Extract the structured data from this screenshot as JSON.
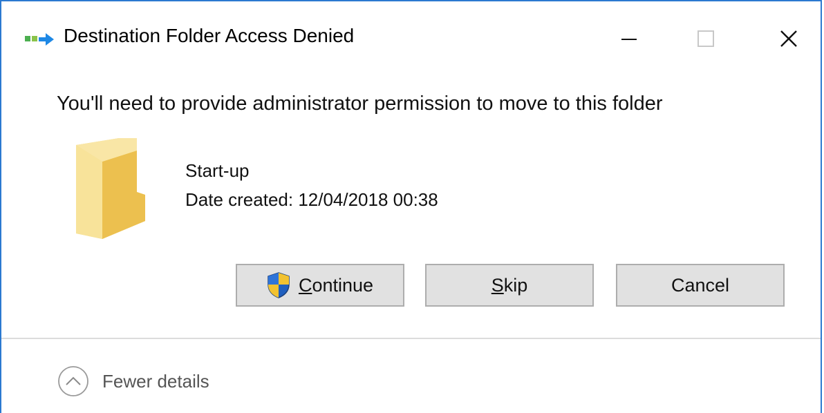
{
  "window": {
    "title": "Destination Folder Access Denied",
    "controls": {
      "minimize_icon": "minimize-icon",
      "maximize_icon": "maximize-icon",
      "close_icon": "close-icon"
    },
    "accent_color": "#2b79d0"
  },
  "message": "You'll need to provide administrator permission to move to this folder",
  "item": {
    "icon": "folder-icon",
    "name": "Start-up",
    "date_created": "Date created: 12/04/2018 00:38"
  },
  "buttons": {
    "continue": {
      "label_accel": "C",
      "label_rest": "ontinue",
      "icon": "uac-shield-icon"
    },
    "skip": {
      "label_accel": "S",
      "label_rest": "kip"
    },
    "cancel": {
      "label": "Cancel"
    }
  },
  "footer": {
    "details_label": "Fewer details",
    "details_icon": "chevron-up-circle-icon"
  }
}
